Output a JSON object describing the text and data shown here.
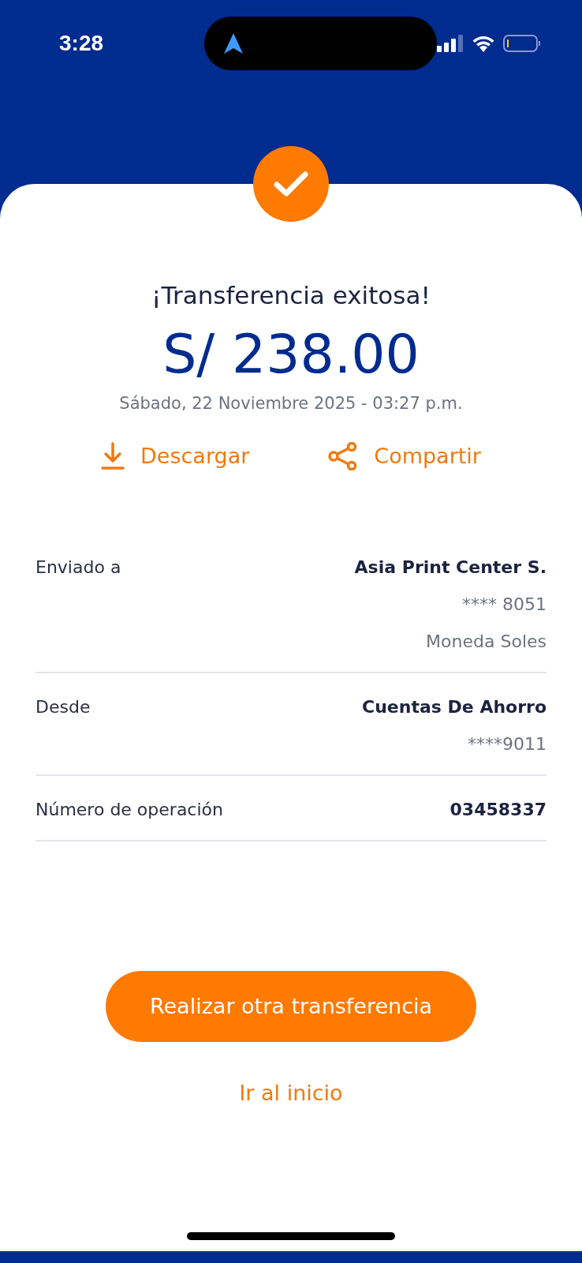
{
  "status_bar": {
    "time": "3:28"
  },
  "title": "¡Transferencia exitosa!",
  "amount": "S/ 238.00",
  "date": "Sábado, 22 Noviembre 2025 - 03:27 p.m.",
  "actions": [
    {
      "label": "Descargar",
      "kind": "download"
    },
    {
      "label": "Compartir",
      "kind": "share"
    }
  ],
  "details": [
    {
      "label": "Enviado a",
      "lines": [
        "Asia Print Center S.",
        "**** 8051",
        "Moneda Soles"
      ]
    },
    {
      "label": "Desde",
      "lines": [
        "Cuentas De Ahorro",
        "****9011"
      ]
    },
    {
      "label": "Número de operación",
      "lines": [
        "03458337"
      ]
    }
  ],
  "primary_button": "Realizar otra transferencia",
  "link": "Ir al inicio"
}
